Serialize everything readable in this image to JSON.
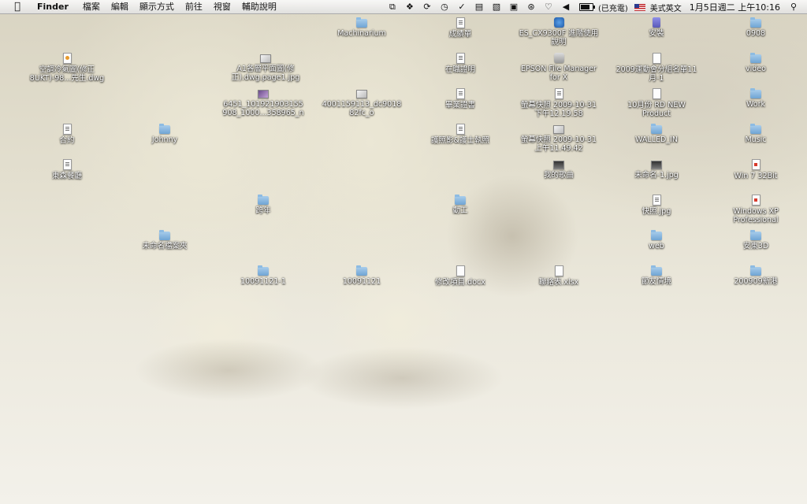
{
  "menubar": {
    "apple_icon": "apple-icon",
    "app_name": "Finder",
    "menus": [
      "檔案",
      "編輯",
      "顯示方式",
      "前往",
      "視窗",
      "輔助說明"
    ],
    "status_icons": [
      "screen-share-icon",
      "dropbox-icon",
      "sync-icon",
      "time-machine-icon",
      "script-icon",
      "memory-icon",
      "input-icon",
      "display-icon",
      "bluetooth-icon",
      "wifi-icon",
      "volume-icon"
    ],
    "battery_text": "(已充電)",
    "input_source_text": "美式英文",
    "clock": "1月5日週二 上午10:16",
    "search_icon": "spotlight-icon"
  },
  "desktop_icons": [
    {
      "label": "Machinarium",
      "type": "folder"
    },
    {
      "label": "成績單",
      "type": "doc"
    },
    {
      "label": "ES_CX9300F 進階使用\n說明",
      "type": "app"
    },
    {
      "label": "安裝",
      "type": "app-purple"
    },
    {
      "label": "0908",
      "type": "folder"
    },
    {
      "label": "空調冷氣圖(修正\n8UKT)-98...先生.dwg",
      "type": "dwg"
    },
    {
      "label": "A1各層平面圖(修\n正).dwg.page1.jpg",
      "type": "image"
    },
    {
      "label": "在職證明",
      "type": "doc"
    },
    {
      "label": "EPSON File Manager\nfor X",
      "type": "app-grey"
    },
    {
      "label": "2009運動會分組名單11\n月-1",
      "type": "doc-plain"
    },
    {
      "label": "video",
      "type": "folder"
    },
    {
      "label": "6451_101921903155\n908_1000...358965_n",
      "type": "photo"
    },
    {
      "label": "4001159113_dc9018\n82fc_o",
      "type": "image"
    },
    {
      "label": "畢業證書",
      "type": "doc"
    },
    {
      "label": "螢幕快照 2009-10-31\n下午12.19.58",
      "type": "doc"
    },
    {
      "label": "10月份 RD NEW\nProduct",
      "type": "doc-plain"
    },
    {
      "label": "Work",
      "type": "folder"
    },
    {
      "label": "合約",
      "type": "doc"
    },
    {
      "label": "Johnny",
      "type": "folder"
    },
    {
      "label": "護照影&護士執照",
      "type": "doc"
    },
    {
      "label": "螢幕快照 2009-10-31\n上午11.49.42",
      "type": "image"
    },
    {
      "label": "WALLED_IN",
      "type": "folder"
    },
    {
      "label": "Music",
      "type": "folder"
    },
    {
      "label": "東森餐廳",
      "type": "doc"
    },
    {
      "label": "我的歌曲",
      "type": "dark"
    },
    {
      "label": "未命名-1.jpg",
      "type": "dark"
    },
    {
      "label": "Win 7 32Bit",
      "type": "pdf"
    },
    {
      "label": "跨年",
      "type": "folder"
    },
    {
      "label": "動工",
      "type": "folder"
    },
    {
      "label": "快照.jpg",
      "type": "doc"
    },
    {
      "label": "Windows XP\nProfessional",
      "type": "pdf"
    },
    {
      "label": "未命名檔案夾",
      "type": "folder"
    },
    {
      "label": "web",
      "type": "folder"
    },
    {
      "label": "安東3D",
      "type": "folder"
    },
    {
      "label": "10091121-1",
      "type": "folder"
    },
    {
      "label": "10091121",
      "type": "folder"
    },
    {
      "label": "修改項目.docx",
      "type": "doc-plain"
    },
    {
      "label": "聯絡表.xlsx",
      "type": "doc-plain"
    },
    {
      "label": "節友情境",
      "type": "folder"
    },
    {
      "label": "200909新港",
      "type": "folder"
    }
  ]
}
